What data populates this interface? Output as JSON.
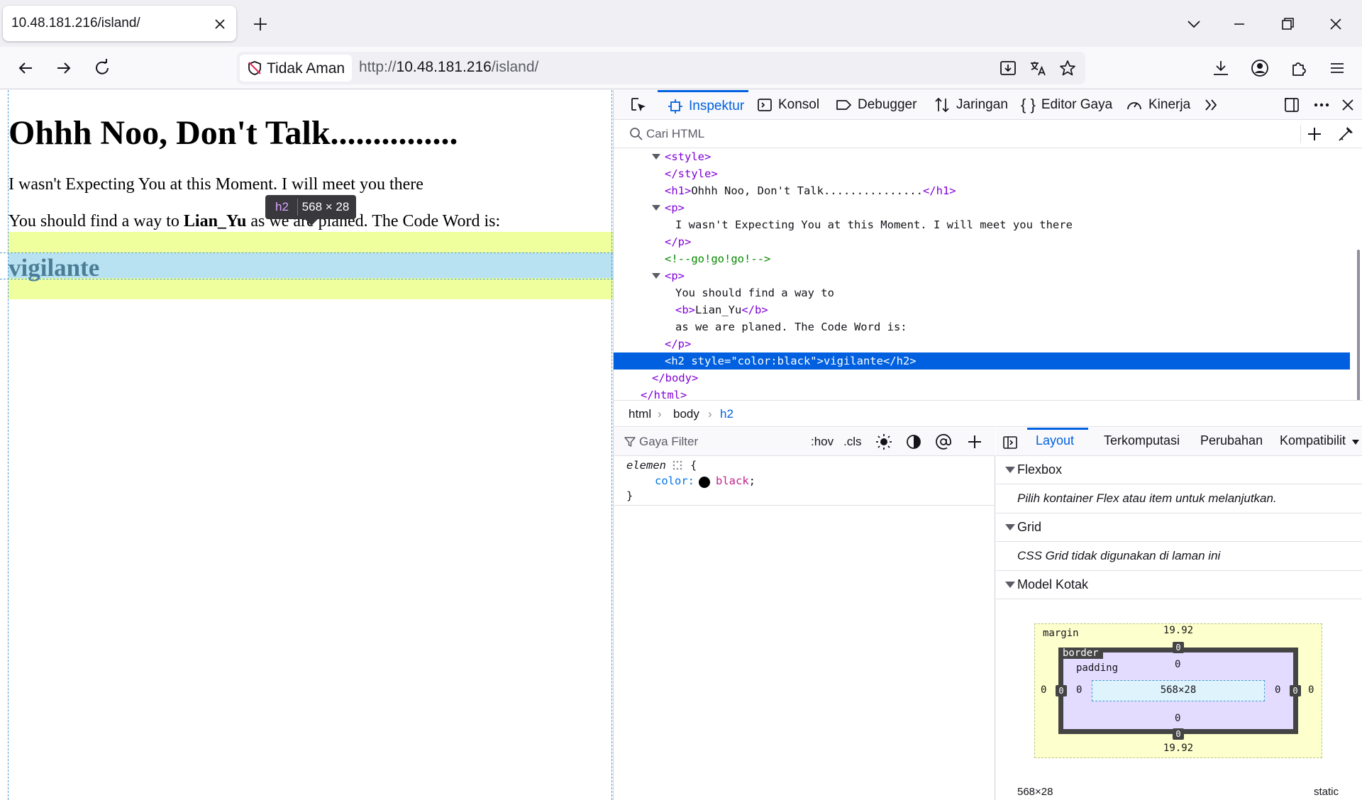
{
  "browser": {
    "tab_title": "10.48.181.216/island/",
    "security_label": "Tidak Aman",
    "url_scheme": "http://",
    "url_host": "10.48.181.216",
    "url_path": "/island/"
  },
  "page": {
    "h1": "Ohhh Noo, Don't Talk...............",
    "p1": "I wasn't Expecting You at this Moment. I will meet you there",
    "p2_before": "You should find a way to ",
    "p2_bold": "Lian_Yu",
    "p2_after": " as we are planed. The Code Word is:",
    "h2": "vigilante",
    "highlighter": {
      "tag": "h2",
      "dims": "568 × 28"
    }
  },
  "devtools": {
    "tabs": [
      "Inspektur",
      "Konsol",
      "Debugger",
      "Jaringan",
      "Editor Gaya",
      "Kinerja"
    ],
    "active_tab": "Inspektur",
    "search_placeholder": "Cari HTML",
    "markup": {
      "style_open": "<style>",
      "style_close": "</style>",
      "h1_tag_open": "<h1>",
      "h1_text": "Ohhh Noo, Don't Talk...............",
      "h1_tag_close": "</h1>",
      "p_open": "<p>",
      "p1_text": "I wasn't Expecting You at this Moment. I will meet you there",
      "p_close": "</p>",
      "comment": "<!--go!go!go!-->",
      "p2_text1": "You should find a way to",
      "b_open": "<b>",
      "b_text": "Lian_Yu",
      "b_close": "</b>",
      "p2_text2": "as we are planed. The Code Word is:",
      "h2_selected": "<h2 style=\"color:black\">vigilante</h2>",
      "body_close": "</body>",
      "html_close": "</html>"
    },
    "breadcrumbs": [
      "html",
      "body",
      "h2"
    ],
    "rules": {
      "filter_placeholder": "Gaya Filter",
      "hov": ":hov",
      "cls": ".cls",
      "selector": "elemen",
      "brace_open": "{",
      "brace_close": "}",
      "prop": "color",
      "value": "black",
      "swatch_color": "#000000"
    },
    "layout": {
      "tabs": [
        "Layout",
        "Terkomputasi",
        "Perubahan",
        "Kompatibilit"
      ],
      "active_tab": "Layout",
      "flexbox_title": "Flexbox",
      "flexbox_msg": "Pilih kontainer Flex atau item untuk melanjutkan.",
      "grid_title": "Grid",
      "grid_msg": "CSS Grid tidak digunakan di laman ini",
      "boxmodel_title": "Model Kotak",
      "boxmodel": {
        "margin_label": "margin",
        "border_label": "border",
        "padding_label": "padding",
        "margin_top": "19.92",
        "margin_bottom": "19.92",
        "margin_left": "0",
        "margin_right": "0",
        "border_top": "0",
        "border_bottom": "0",
        "border_left": "0",
        "border_right": "0",
        "padding_top": "0",
        "padding_bottom": "0",
        "padding_left": "0",
        "padding_right": "0",
        "content": "568×28"
      },
      "footer_size": "568×28",
      "footer_position": "static"
    }
  }
}
